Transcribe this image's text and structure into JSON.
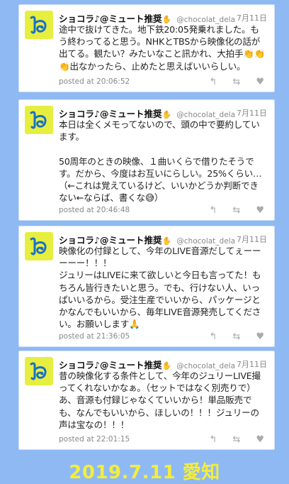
{
  "tweets": [
    {
      "display_name": "ショコラ♪@ミュート推奨",
      "hand_icon": "✋",
      "handle": "@chocolat_dela",
      "date": "7月11日",
      "body": "途中で抜けてきた。地下鉄20:05発乗れました。もう終わってると思う。NHKとTBSから映像化の話が出てる。観たい？みたいなこと訊かれ、大拍手👏👏👏出なかったら、止めたと思えばいいらしい。",
      "timestamp": "posted at 20:06:52"
    },
    {
      "display_name": "ショコラ♪@ミュート推奨",
      "hand_icon": "✋",
      "handle": "@chocolat_dela",
      "date": "7月11日",
      "body": "本日は全くメモってないので、頭の中で要約しています。\n\n50周年のときの映像、１曲いくらで借りたそうです。だから、今度はお互いにらしい。25%くらい…（←これは覚えているけど、いいかどうか判断できない←ならば、書くな😅）",
      "timestamp": "posted at 20:46:48"
    },
    {
      "display_name": "ショコラ♪@ミュート推奨",
      "hand_icon": "✋",
      "handle": "@chocolat_dela",
      "date": "7月11日",
      "body": "映像化の付録として、今年のLIVE音源だしてぇーーーーー！！！\nジュリーはLIVEに来て欲しいと今日も言ってた！もちろん皆行きたいと思う。でも、行けない人、いっぱいいるから。受注生産でいいから、パッケージとかなんでもいいから、毎年LIVE音源発売してください。お願いします🙏",
      "timestamp": "posted at 21:36:05"
    },
    {
      "display_name": "ショコラ♪@ミュート推奨",
      "hand_icon": "✋",
      "handle": "@chocolat_dela",
      "date": "7月11日",
      "body": "昔の映像化する条件として、今年のジュリーLIVE撮ってくれないかなぁ。（セットではなく別売りで）あ、音源も付録じゃなくていいから！単品販売でも、なんでもいいから、ほしいの！！！ジュリーの声は宝なの！！！",
      "timestamp": "posted at 22:01:15"
    }
  ],
  "actions": {
    "reply_icon": "reply-icon",
    "retweet_icon": "retweet-icon",
    "like_icon": "heart-icon"
  },
  "footer": {
    "caption": "2019.7.11 愛知"
  },
  "colors": {
    "background": "#8fb9f3",
    "avatar_bg": "#e6ef3f",
    "footer_text": "#f4ee3a"
  }
}
